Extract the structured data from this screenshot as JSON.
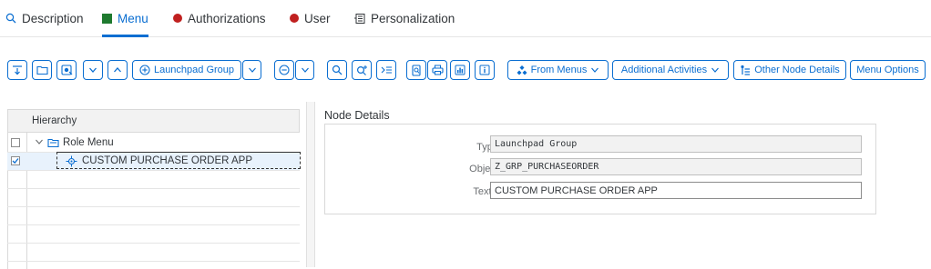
{
  "tabs": [
    {
      "label": "Description",
      "icon": "magnifier-icon"
    },
    {
      "label": "Menu",
      "icon": "green-square-icon",
      "active": true
    },
    {
      "label": "Authorizations",
      "icon": "red-dot-icon"
    },
    {
      "label": "User",
      "icon": "red-dot-icon"
    },
    {
      "label": "Personalization",
      "icon": "personalization-icon"
    }
  ],
  "toolbar": {
    "launchpad_group": "Launchpad Group",
    "from_menus": "From Menus",
    "additional_activities": "Additional Activities",
    "other_node_details": "Other Node Details",
    "menu_options": "Menu Options"
  },
  "hierarchy": {
    "header": "Hierarchy",
    "nodes": [
      {
        "label": "Role Menu",
        "icon": "folder-icon",
        "checked": false,
        "expanded": true
      },
      {
        "label": "CUSTOM PURCHASE ORDER APP",
        "icon": "launchpad-group-icon",
        "checked": true,
        "selected": true
      }
    ]
  },
  "node_details": {
    "title": "Node Details",
    "type_label": "Type:",
    "type_value": "Launchpad Group",
    "object_label": "Object:",
    "object_value": "Z_GRP_PURCHASEORDER",
    "text_label": "Text:",
    "text_required": "*",
    "text_value": "CUSTOM PURCHASE ORDER APP"
  },
  "colors": {
    "accent": "#0a6ed1",
    "menu_status": "#1f7a2f",
    "incomplete_status": "#c0201f"
  }
}
